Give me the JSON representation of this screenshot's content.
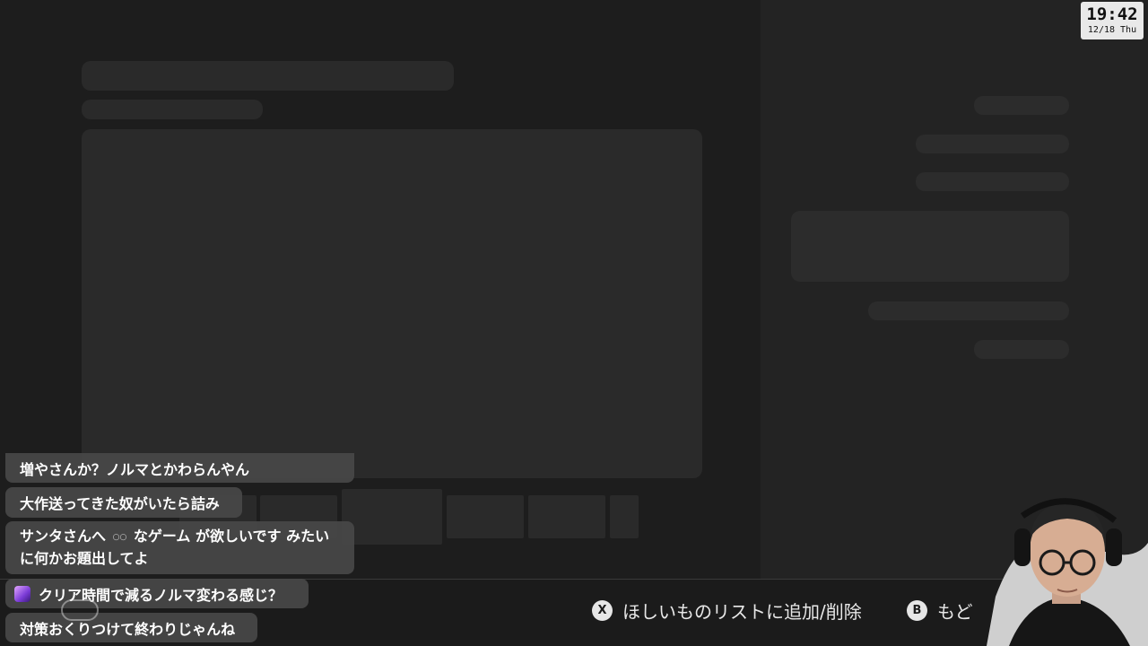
{
  "clock": {
    "time": "19:42",
    "date": "12/18 Thu"
  },
  "hints": {
    "x_button": "X",
    "x_label": "ほしいものリストに追加/削除",
    "b_button": "B",
    "b_label": "もど"
  },
  "chat": {
    "messages": [
      {
        "text": "増やさんか？ノルマとかわらんやん"
      },
      {
        "text": "大作送ってきた奴がいたら詰み"
      },
      {
        "text_before": "サンタさんへ",
        "emoji": "○○",
        "text_after": "なゲーム が欲しいです みたい に何かお題出してよ"
      },
      {
        "text": "クリア時間で減るノルマ変わる感じ？"
      },
      {
        "text": "対策おくりつけて終わりじゃんね"
      }
    ]
  },
  "icons": {
    "chat_avatar": "user-avatar-icon",
    "controller_overlay": "gamepad-icon"
  },
  "colors": {
    "background": "#1c1c1c",
    "right_pane": "#232323",
    "placeholder": "#2a2a2a",
    "chat_bubble": "#484848",
    "clock_bg": "#e9e9e9"
  }
}
